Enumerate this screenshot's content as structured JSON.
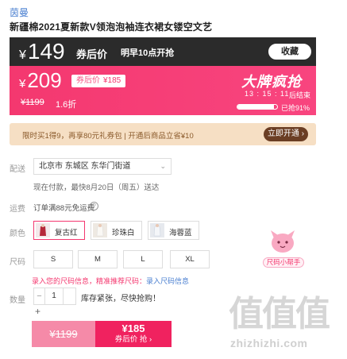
{
  "shop": {
    "brand": "茵曼"
  },
  "product": {
    "title": "新疆棉2021夏新款V领泡泡袖连衣裙女镂空文艺"
  },
  "promo_top": {
    "currency": "¥",
    "price": "149",
    "after_label": "券后价",
    "start_text": "明早10点开抢",
    "fav_label": "收藏"
  },
  "promo_main": {
    "currency": "¥",
    "price": "209",
    "after_tag_label": "券后价",
    "after_tag_price": "¥185",
    "original_price": "¥1199",
    "discount": "1.6折",
    "event_title": "大牌疯抢",
    "countdown": "13 : 15 : 11",
    "countdown_label": "后结束",
    "progress_fraction": 0.91,
    "progress_label": "已抢91%"
  },
  "coupon": {
    "text": "限时买1得9，再享80元礼券包 | 开通后商品立省¥10",
    "button_label": "立即开通 ›"
  },
  "delivery": {
    "label": "配送",
    "address": "北京市 东城区 东华门街道",
    "eta": "现在付款，最快8月20日（周五）送达"
  },
  "shipping": {
    "label": "运费",
    "text": "订单满88元免运费",
    "help_icon": "question-icon"
  },
  "colors": {
    "label": "颜色",
    "options": [
      "复古红",
      "珍珠白",
      "海蓉蓝"
    ],
    "selected": "复古红"
  },
  "sizes": {
    "label": "尺码",
    "options": [
      "S",
      "M",
      "L",
      "XL"
    ]
  },
  "size_helper": {
    "label": "尺码小帮手",
    "icon": "mascot-icon"
  },
  "size_hint": {
    "text": "录入您的尺码信息，精准推荐尺码：",
    "link": "录入尺码信息"
  },
  "quantity": {
    "label": "数量",
    "value": "1",
    "minus": "−",
    "plus": "+",
    "stock_tip": "库存紧张，尽快抢购！"
  },
  "buy": {
    "left_price": "¥1199",
    "right_price": "¥185",
    "right_sub": "券后价 抢 ›"
  },
  "watermark": {
    "glyphs": "值值值",
    "url": "zhizhizhi.com"
  },
  "colors_theme": {
    "accent": "#f4386f",
    "dark": "#2b2b2b",
    "coupon_bg": "#f6dfc4"
  }
}
